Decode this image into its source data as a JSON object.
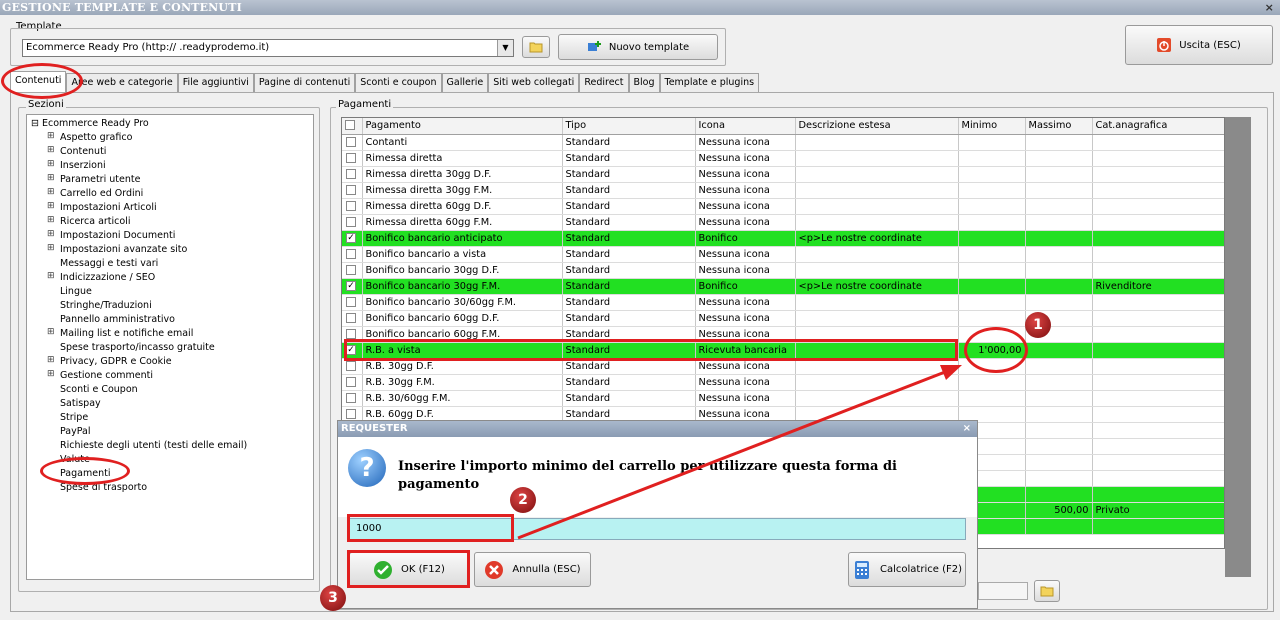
{
  "window": {
    "title": "GESTIONE TEMPLATE E CONTENUTI",
    "close_glyph": "×"
  },
  "template_group": {
    "label": "Template",
    "selected": "Ecommerce Ready Pro (http://     .readyprodemo.it)",
    "new_template_label": "Nuovo template",
    "exit_label": "Uscita (ESC)"
  },
  "tabs": [
    {
      "label": "Contenuti",
      "active": true
    },
    {
      "label": "Aree web e categorie"
    },
    {
      "label": "File aggiuntivi"
    },
    {
      "label": "Pagine di contenuti"
    },
    {
      "label": "Sconti e coupon"
    },
    {
      "label": "Gallerie"
    },
    {
      "label": "Siti web collegati"
    },
    {
      "label": "Redirect"
    },
    {
      "label": "Blog"
    },
    {
      "label": "Template e plugins"
    }
  ],
  "sections": {
    "label": "Sezioni",
    "root": "Ecommerce Ready Pro",
    "items": [
      {
        "label": "Aspetto grafico",
        "expandable": true
      },
      {
        "label": "Contenuti",
        "expandable": true
      },
      {
        "label": "Inserzioni",
        "expandable": true
      },
      {
        "label": "Parametri utente",
        "expandable": true
      },
      {
        "label": "Carrello ed Ordini",
        "expandable": true
      },
      {
        "label": "Impostazioni Articoli",
        "expandable": true
      },
      {
        "label": "Ricerca articoli",
        "expandable": true
      },
      {
        "label": "Impostazioni Documenti",
        "expandable": true
      },
      {
        "label": "Impostazioni avanzate sito",
        "expandable": true
      },
      {
        "label": "Messaggi e testi vari",
        "expandable": false
      },
      {
        "label": "Indicizzazione / SEO",
        "expandable": true
      },
      {
        "label": "Lingue",
        "expandable": false
      },
      {
        "label": "Stringhe/Traduzioni",
        "expandable": false
      },
      {
        "label": "Pannello amministrativo",
        "expandable": false
      },
      {
        "label": "Mailing list e notifiche email",
        "expandable": true
      },
      {
        "label": "Spese trasporto/incasso gratuite",
        "expandable": false
      },
      {
        "label": "Privacy, GDPR e Cookie",
        "expandable": true
      },
      {
        "label": "Gestione commenti",
        "expandable": true
      },
      {
        "label": "Sconti e Coupon",
        "expandable": false
      },
      {
        "label": "Satispay",
        "expandable": false
      },
      {
        "label": "Stripe",
        "expandable": false
      },
      {
        "label": "PayPal",
        "expandable": false
      },
      {
        "label": "Richieste degli utenti (testi delle email)",
        "expandable": false
      },
      {
        "label": "Valute",
        "expandable": false
      },
      {
        "label": "Pagamenti",
        "expandable": false,
        "selected": true
      },
      {
        "label": "Spese di trasporto",
        "expandable": false
      }
    ]
  },
  "payments": {
    "label": "Pagamenti",
    "columns": [
      "Pagamento",
      "Tipo",
      "Icona",
      "Descrizione estesa",
      "Minimo",
      "Massimo",
      "Cat.anagrafica"
    ],
    "rows": [
      {
        "checked": false,
        "name": "Contanti",
        "tipo": "Standard",
        "icona": "Nessuna icona",
        "desc": "",
        "min": "",
        "max": "",
        "cat": "",
        "green": false
      },
      {
        "checked": false,
        "name": "Rimessa diretta",
        "tipo": "Standard",
        "icona": "Nessuna icona",
        "desc": "",
        "min": "",
        "max": "",
        "cat": "",
        "green": false
      },
      {
        "checked": false,
        "name": "Rimessa diretta 30gg D.F.",
        "tipo": "Standard",
        "icona": "Nessuna icona",
        "desc": "",
        "min": "",
        "max": "",
        "cat": "",
        "green": false
      },
      {
        "checked": false,
        "name": "Rimessa diretta 30gg F.M.",
        "tipo": "Standard",
        "icona": "Nessuna icona",
        "desc": "",
        "min": "",
        "max": "",
        "cat": "",
        "green": false
      },
      {
        "checked": false,
        "name": "Rimessa diretta 60gg D.F.",
        "tipo": "Standard",
        "icona": "Nessuna icona",
        "desc": "",
        "min": "",
        "max": "",
        "cat": "",
        "green": false
      },
      {
        "checked": false,
        "name": "Rimessa diretta 60gg F.M.",
        "tipo": "Standard",
        "icona": "Nessuna icona",
        "desc": "",
        "min": "",
        "max": "",
        "cat": "",
        "green": false
      },
      {
        "checked": true,
        "name": "Bonifico bancario anticipato",
        "tipo": "Standard",
        "icona": "Bonifico",
        "desc": "<p>Le nostre coordinate",
        "min": "",
        "max": "",
        "cat": "",
        "green": true
      },
      {
        "checked": false,
        "name": "Bonifico bancario a vista",
        "tipo": "Standard",
        "icona": "Nessuna icona",
        "desc": "",
        "min": "",
        "max": "",
        "cat": "",
        "green": false
      },
      {
        "checked": false,
        "name": "Bonifico bancario 30gg D.F.",
        "tipo": "Standard",
        "icona": "Nessuna icona",
        "desc": "",
        "min": "",
        "max": "",
        "cat": "",
        "green": false
      },
      {
        "checked": true,
        "name": "Bonifico bancario 30gg F.M.",
        "tipo": "Standard",
        "icona": "Bonifico",
        "desc": "<p>Le nostre coordinate",
        "min": "",
        "max": "",
        "cat": "Rivenditore",
        "green": true
      },
      {
        "checked": false,
        "name": "Bonifico bancario 30/60gg F.M.",
        "tipo": "Standard",
        "icona": "Nessuna icona",
        "desc": "",
        "min": "",
        "max": "",
        "cat": "",
        "green": false
      },
      {
        "checked": false,
        "name": "Bonifico bancario 60gg D.F.",
        "tipo": "Standard",
        "icona": "Nessuna icona",
        "desc": "",
        "min": "",
        "max": "",
        "cat": "",
        "green": false
      },
      {
        "checked": false,
        "name": "Bonifico bancario 60gg F.M.",
        "tipo": "Standard",
        "icona": "Nessuna icona",
        "desc": "",
        "min": "",
        "max": "",
        "cat": "",
        "green": false
      },
      {
        "checked": true,
        "name": "R.B. a vista",
        "tipo": "Standard",
        "icona": "Ricevuta bancaria",
        "desc": "",
        "min": "1'000,00",
        "max": "",
        "cat": "",
        "green": true
      },
      {
        "checked": false,
        "name": "R.B. 30gg D.F.",
        "tipo": "Standard",
        "icona": "Nessuna icona",
        "desc": "",
        "min": "",
        "max": "",
        "cat": "",
        "green": false
      },
      {
        "checked": false,
        "name": "R.B. 30gg F.M.",
        "tipo": "Standard",
        "icona": "Nessuna icona",
        "desc": "",
        "min": "",
        "max": "",
        "cat": "",
        "green": false
      },
      {
        "checked": false,
        "name": "R.B. 30/60gg F.M.",
        "tipo": "Standard",
        "icona": "Nessuna icona",
        "desc": "",
        "min": "",
        "max": "",
        "cat": "",
        "green": false
      },
      {
        "checked": false,
        "name": "R.B. 60gg D.F.",
        "tipo": "Standard",
        "icona": "Nessuna icona",
        "desc": "",
        "min": "",
        "max": "",
        "cat": "",
        "green": false
      },
      {
        "checked": false,
        "name": "",
        "tipo": "",
        "icona": "",
        "desc": "",
        "min": "",
        "max": "",
        "cat": "",
        "green": false
      },
      {
        "checked": false,
        "name": "",
        "tipo": "",
        "icona": "",
        "desc": "",
        "min": "",
        "max": "",
        "cat": "",
        "green": false
      },
      {
        "checked": false,
        "name": "",
        "tipo": "",
        "icona": "",
        "desc": "",
        "min": "",
        "max": "",
        "cat": "",
        "green": false
      },
      {
        "checked": false,
        "name": "",
        "tipo": "",
        "icona": "",
        "desc": "",
        "min": "",
        "max": "",
        "cat": "",
        "green": false
      },
      {
        "checked": false,
        "name": "",
        "tipo": "",
        "icona": "",
        "desc": "",
        "min": "",
        "max": "",
        "cat": "",
        "green": true
      },
      {
        "checked": false,
        "name": "",
        "tipo": "",
        "icona": "",
        "desc": "",
        "min": "",
        "max": "500,00",
        "cat": "Privato",
        "green": true
      },
      {
        "checked": false,
        "name": "",
        "tipo": "",
        "icona": "",
        "desc": "",
        "min": "",
        "max": "",
        "cat": "",
        "green": true
      }
    ]
  },
  "dialog": {
    "title": "REQUESTER",
    "close_glyph": "×",
    "message": "Inserire l'importo minimo del carrello per utilizzare questa forma di pagamento",
    "value": "1000",
    "ok_label": "OK (F12)",
    "cancel_label": "Annulla (ESC)",
    "calc_label": "Calcolatrice (F2)"
  },
  "callouts": [
    "1",
    "2",
    "3"
  ],
  "colors": {
    "highlight_green": "#22e022",
    "callout_red": "#e02020",
    "input_cyan": "#b8f2f2"
  }
}
